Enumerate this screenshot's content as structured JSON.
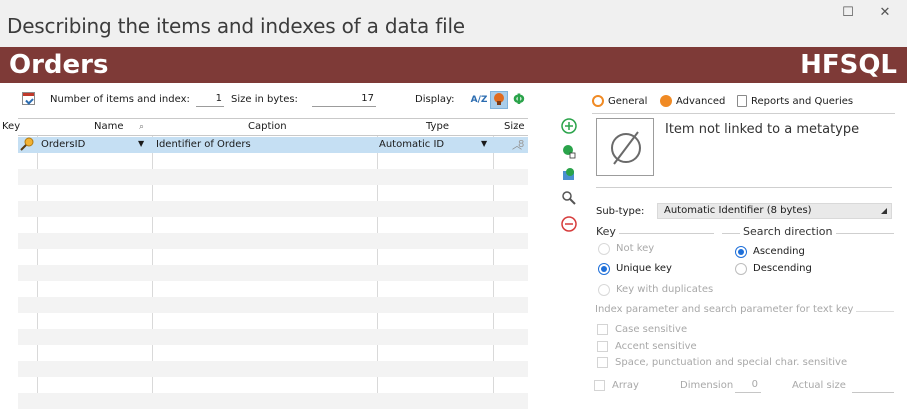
{
  "window": {
    "title": "Describing the items and indexes of a data file",
    "maximize_glyph": "☐",
    "close_glyph": "✕"
  },
  "banner": {
    "file_name": "Orders",
    "engine": "HFSQL",
    "color": "#7e3a37"
  },
  "toolbar": {
    "count_label": "Number of items and index:",
    "count_value": "1",
    "size_label": "Size in bytes:",
    "size_value": "17",
    "display_label": "Display:",
    "az_button": "A/Z"
  },
  "grid": {
    "columns": {
      "key": "Key",
      "name": "Name",
      "caption": "Caption",
      "type": "Type",
      "size": "Size"
    },
    "rows": [
      {
        "name": "OrdersID",
        "caption": "Identifier of Orders",
        "type": "Automatic ID",
        "size": "8"
      }
    ]
  },
  "side_buttons": [
    "add-item-icon",
    "add-composite-key-icon",
    "import-items-icon",
    "find-item-icon",
    "delete-item-icon"
  ],
  "tabs": {
    "general": "General",
    "advanced": "Advanced",
    "reports": "Reports and Queries"
  },
  "general": {
    "metatype_text": "Item not linked to a metatype",
    "subtype_label": "Sub-type:",
    "subtype_value": "Automatic Identifier (8 bytes)",
    "key_group": "Key",
    "key_options": [
      "Not key",
      "Unique key",
      "Key with duplicates"
    ],
    "direction_group": "Search direction",
    "direction_options": [
      "Ascending",
      "Descending"
    ],
    "index_group": "Index parameter and search parameter for text key",
    "index_options": [
      "Case sensitive",
      "Accent sensitive",
      "Space, punctuation and special char. sensitive"
    ],
    "array_label": "Array",
    "dimension_label": "Dimension",
    "dimension_value": "0",
    "actual_size_label": "Actual size"
  },
  "colors": {
    "accent": "#1e6fd9",
    "selection": "#c5dff3",
    "tab_orange": "#f08a24"
  }
}
